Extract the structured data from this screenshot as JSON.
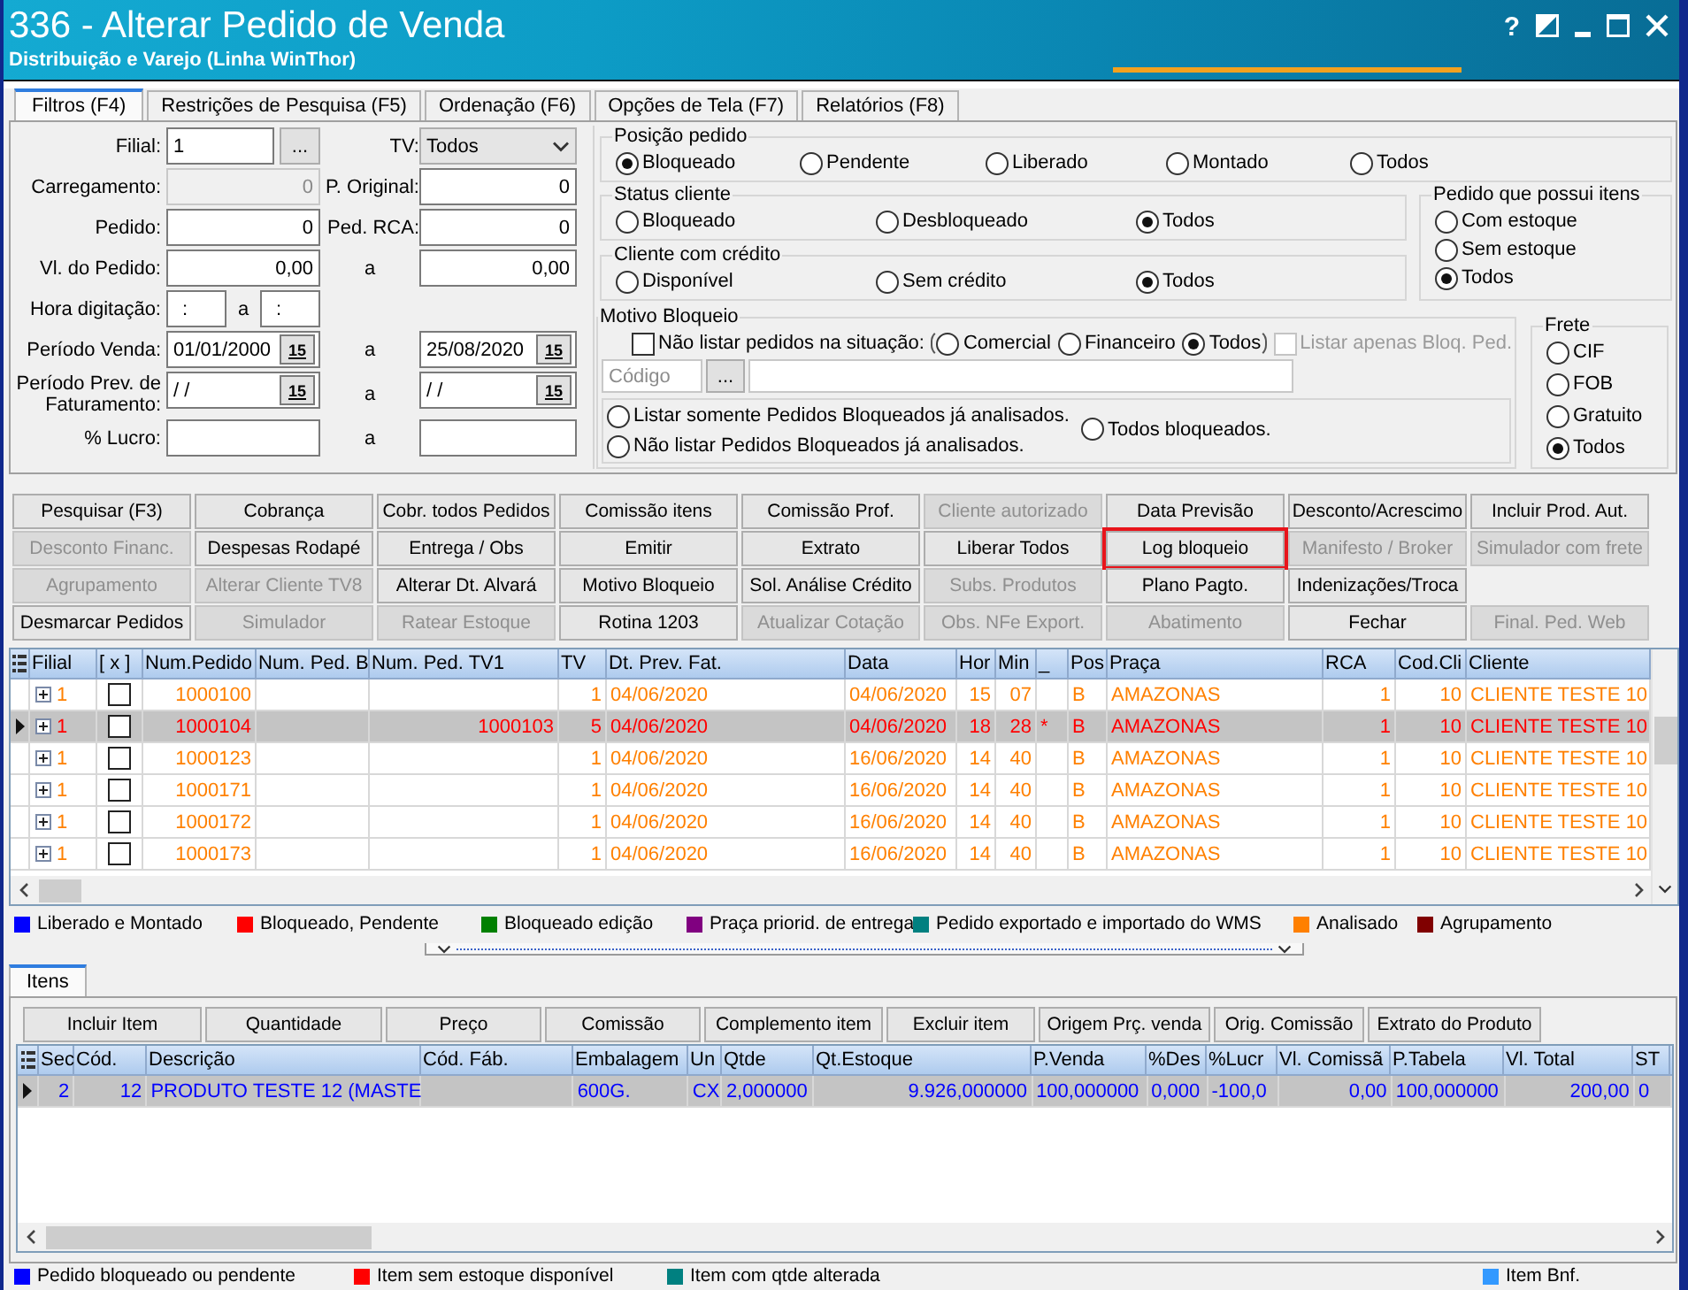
{
  "window": {
    "title": "336 - Alterar Pedido de Venda",
    "subtitle": "Distribuição e Varejo (Linha WinThor)",
    "help": "?"
  },
  "tabs": [
    {
      "label": "Filtros (F4)",
      "selected": true
    },
    {
      "label": "Restrições de Pesquisa (F5)",
      "selected": false
    },
    {
      "label": "Ordenação (F6)",
      "selected": false
    },
    {
      "label": "Opções de Tela (F7)",
      "selected": false
    },
    {
      "label": "Relatórios (F8)",
      "selected": false
    }
  ],
  "form_rows": [
    {
      "kind": "pair",
      "label": "Filial:",
      "field": {
        "kind": "lookup",
        "value": "1",
        "button": "...",
        "disabled": false
      },
      "mid_label": "TV:",
      "field2": {
        "kind": "select",
        "value": "Todos",
        "disabled": false
      }
    },
    {
      "kind": "pair",
      "label": "Carregamento:",
      "field": {
        "kind": "number",
        "value": "0",
        "disabled": true
      },
      "mid_label": "P. Original:",
      "field2": {
        "kind": "number",
        "value": "0",
        "disabled": false
      }
    },
    {
      "kind": "pair",
      "label": "Pedido:",
      "field": {
        "kind": "number",
        "value": "0",
        "disabled": false
      },
      "mid_label": "Ped. RCA:",
      "field2": {
        "kind": "number",
        "value": "0",
        "disabled": false
      }
    },
    {
      "kind": "range",
      "label": "Vl. do Pedido:",
      "field": {
        "kind": "number",
        "value": "0,00",
        "disabled": false
      },
      "mid_label": "a",
      "field2": {
        "kind": "number",
        "value": "0,00",
        "disabled": false
      }
    },
    {
      "kind": "single",
      "label": "Hora digitação:",
      "field": {
        "kind": "time",
        "value": ":",
        "sep": "a",
        "value2": ":",
        "disabled": false
      }
    },
    {
      "kind": "range",
      "label": "Período Venda:",
      "field": {
        "kind": "date",
        "value": "01/01/2000",
        "picker": "15",
        "disabled": false
      },
      "mid_label": "a",
      "field2": {
        "kind": "date",
        "value": "25/08/2020",
        "picker": "15",
        "disabled": false
      }
    },
    {
      "kind": "range",
      "label": "Período Prev. de Faturamento:",
      "field": {
        "kind": "date",
        "value": "/ /",
        "picker": "15",
        "disabled": false
      },
      "mid_label": "a",
      "field2": {
        "kind": "date",
        "value": "/ /",
        "picker": "15",
        "disabled": false
      }
    },
    {
      "kind": "range",
      "label": "% Lucro:",
      "field": {
        "kind": "number",
        "disabled": false
      },
      "mid_label": "a",
      "field2": {
        "kind": "number",
        "disabled": false
      }
    }
  ],
  "posicao": {
    "title": "Posição pedido",
    "options": [
      {
        "label": "Bloqueado",
        "selected": true
      },
      {
        "label": "Pendente",
        "selected": false
      },
      {
        "label": "Liberado",
        "selected": false
      },
      {
        "label": "Montado",
        "selected": false
      },
      {
        "label": "Todos",
        "selected": false
      }
    ]
  },
  "status_cliente": {
    "title": "Status cliente",
    "options": [
      {
        "label": "Bloqueado",
        "selected": false
      },
      {
        "label": "Desbloqueado",
        "selected": false
      },
      {
        "label": "Todos",
        "selected": true
      }
    ]
  },
  "credito": {
    "title": "Cliente com crédito",
    "options": [
      {
        "label": "Disponível",
        "selected": false
      },
      {
        "label": "Sem crédito",
        "selected": false
      },
      {
        "label": "Todos",
        "selected": true
      }
    ]
  },
  "itens_estoque": {
    "title": "Pedido que possui itens",
    "options": [
      {
        "label": "Com estoque",
        "selected": false
      },
      {
        "label": "Sem estoque",
        "selected": false
      },
      {
        "label": "Todos",
        "selected": true
      }
    ]
  },
  "motivo": {
    "title": "Motivo Bloqueio",
    "exclude": {
      "label": "Não listar pedidos na situação:",
      "checked": false
    },
    "situacao": [
      {
        "label": "Comercial",
        "selected": false
      },
      {
        "label": "Financeiro",
        "selected": false
      },
      {
        "label": "Todos",
        "selected": true
      }
    ],
    "only_blocked": {
      "label": "Listar apenas Bloq. Ped.",
      "checked": false,
      "disabled": true
    },
    "codigo": {
      "placeholder": "Código",
      "button": "..."
    },
    "analise": [
      {
        "label": "Listar somente Pedidos Bloqueados já analisados.",
        "selected": false
      },
      {
        "label": "Não listar Pedidos Bloqueados já analisados.",
        "selected": false
      },
      {
        "label": "Todos bloqueados.",
        "selected": false
      }
    ]
  },
  "frete": {
    "title": "Frete",
    "options": [
      {
        "label": "CIF",
        "selected": false
      },
      {
        "label": "FOB",
        "selected": false
      },
      {
        "label": "Gratuito",
        "selected": false
      },
      {
        "label": "Todos",
        "selected": true
      }
    ]
  },
  "actions": [
    [
      {
        "label": "Pesquisar (F3)",
        "disabled": false,
        "highlighted": false
      },
      {
        "label": "Cobrança",
        "disabled": false,
        "highlighted": false
      },
      {
        "label": "Cobr. todos Pedidos",
        "disabled": false,
        "highlighted": false
      },
      {
        "label": "Comissão itens",
        "disabled": false,
        "highlighted": false
      },
      {
        "label": "Comissão Prof.",
        "disabled": false,
        "highlighted": false
      },
      {
        "label": "Cliente autorizado",
        "disabled": true,
        "highlighted": false
      },
      {
        "label": "Data Previsão",
        "disabled": false,
        "highlighted": false
      },
      {
        "label": "Desconto/Acrescimo",
        "disabled": false,
        "highlighted": false
      },
      {
        "label": "Incluir Prod. Aut.",
        "disabled": false,
        "highlighted": false
      }
    ],
    [
      {
        "label": "Desconto Financ.",
        "disabled": true,
        "highlighted": false
      },
      {
        "label": "Despesas Rodapé",
        "disabled": false,
        "highlighted": false
      },
      {
        "label": "Entrega / Obs",
        "disabled": false,
        "highlighted": false
      },
      {
        "label": "Emitir",
        "disabled": false,
        "highlighted": false
      },
      {
        "label": "Extrato",
        "disabled": false,
        "highlighted": false
      },
      {
        "label": "Liberar Todos",
        "disabled": false,
        "highlighted": false
      },
      {
        "label": "Log bloqueio",
        "disabled": false,
        "highlighted": true
      },
      {
        "label": "Manifesto / Broker",
        "disabled": true,
        "highlighted": false
      },
      {
        "label": "Simulador com frete",
        "disabled": true,
        "highlighted": false
      }
    ],
    [
      {
        "label": "Agrupamento",
        "disabled": true,
        "highlighted": false
      },
      {
        "label": "Alterar Cliente TV8",
        "disabled": true,
        "highlighted": false
      },
      {
        "label": "Alterar Dt. Alvará",
        "disabled": false,
        "highlighted": false
      },
      {
        "label": "Motivo Bloqueio",
        "disabled": false,
        "highlighted": false
      },
      {
        "label": "Sol. Análise Crédito",
        "disabled": false,
        "highlighted": false
      },
      {
        "label": "Subs. Produtos",
        "disabled": true,
        "highlighted": false
      },
      {
        "label": "Plano Pagto.",
        "disabled": false,
        "highlighted": false
      },
      {
        "label": "Indenizações/Troca",
        "disabled": false,
        "highlighted": false
      }
    ],
    [
      {
        "label": "Desmarcar Pedidos",
        "disabled": false,
        "highlighted": false
      },
      {
        "label": "Simulador",
        "disabled": true,
        "highlighted": false
      },
      {
        "label": "Ratear Estoque",
        "disabled": true,
        "highlighted": false
      },
      {
        "label": "Rotina 1203",
        "disabled": false,
        "highlighted": false
      },
      {
        "label": "Atualizar Cotação",
        "disabled": true,
        "highlighted": false
      },
      {
        "label": "Obs. NFe Export.",
        "disabled": true,
        "highlighted": false
      },
      {
        "label": "Abatimento",
        "disabled": true,
        "highlighted": false
      },
      {
        "label": "Fechar",
        "disabled": false,
        "highlighted": false
      },
      {
        "label": "Final. Ped. Web",
        "disabled": true,
        "highlighted": false
      }
    ]
  ],
  "orders": {
    "columns": [
      "Filial",
      "[ x ]",
      "Num.Pedido",
      "Num. Ped. B",
      "Num. Ped. TV1",
      "TV",
      "Dt. Prev. Fat.",
      "Data",
      "Hor",
      "Min",
      "_",
      "Pos",
      "Praça",
      "RCA",
      "Cod.Cli",
      "Cliente"
    ],
    "rows": [
      {
        "selected": false,
        "color": "#ff8000",
        "expanded": false,
        "checked": false,
        "filial": "1",
        "num_pedido": "1000100",
        "tv": "1",
        "dt_prev_fat": "04/06/2020",
        "data": "04/06/2020",
        "hora": "15",
        "minuto": "07",
        "pos": "B",
        "praca": "AMAZONAS",
        "rca": "1",
        "cod_cli": "10",
        "cliente": "CLIENTE TESTE 10"
      },
      {
        "selected": true,
        "color": "#ff0000",
        "expanded": false,
        "checked": false,
        "filial": "1",
        "num_pedido": "1000104",
        "num_ped_tv1": "1000103",
        "tv": "5",
        "dt_prev_fat": "04/06/2020",
        "data": "04/06/2020",
        "hora": "18",
        "minuto": "28",
        "flag": "*",
        "pos": "B",
        "praca": "AMAZONAS",
        "rca": "1",
        "cod_cli": "10",
        "cliente": "CLIENTE TESTE 10"
      },
      {
        "selected": false,
        "color": "#ff8000",
        "expanded": false,
        "checked": false,
        "filial": "1",
        "num_pedido": "1000123",
        "tv": "1",
        "dt_prev_fat": "04/06/2020",
        "data": "16/06/2020",
        "hora": "14",
        "minuto": "40",
        "pos": "B",
        "praca": "AMAZONAS",
        "rca": "1",
        "cod_cli": "10",
        "cliente": "CLIENTE TESTE 10"
      },
      {
        "selected": false,
        "color": "#ff8000",
        "expanded": false,
        "checked": false,
        "filial": "1",
        "num_pedido": "1000171",
        "tv": "1",
        "dt_prev_fat": "04/06/2020",
        "data": "16/06/2020",
        "hora": "14",
        "minuto": "40",
        "pos": "B",
        "praca": "AMAZONAS",
        "rca": "1",
        "cod_cli": "10",
        "cliente": "CLIENTE TESTE 10"
      },
      {
        "selected": false,
        "color": "#ff8000",
        "expanded": false,
        "checked": false,
        "filial": "1",
        "num_pedido": "1000172",
        "tv": "1",
        "dt_prev_fat": "04/06/2020",
        "data": "16/06/2020",
        "hora": "14",
        "minuto": "40",
        "pos": "B",
        "praca": "AMAZONAS",
        "rca": "1",
        "cod_cli": "10",
        "cliente": "CLIENTE TESTE 10"
      },
      {
        "selected": false,
        "color": "#ff8000",
        "expanded": false,
        "checked": false,
        "filial": "1",
        "num_pedido": "1000173",
        "tv": "1",
        "dt_prev_fat": "04/06/2020",
        "data": "16/06/2020",
        "hora": "14",
        "minuto": "40",
        "pos": "B",
        "praca": "AMAZONAS",
        "rca": "1",
        "cod_cli": "10",
        "cliente": "CLIENTE TESTE 10"
      }
    ]
  },
  "order_legend": [
    {
      "label": "Liberado e Montado",
      "color": "#0000ff"
    },
    {
      "label": "Bloqueado, Pendente",
      "color": "#ff0000"
    },
    {
      "label": "Bloqueado edição",
      "color": "#008000"
    },
    {
      "label": "Praça priorid. de entrega",
      "color": "#800080"
    },
    {
      "label": "Pedido exportado e importado do WMS",
      "color": "#008080"
    },
    {
      "label": "Analisado",
      "color": "#ff8000"
    },
    {
      "label": "Agrupamento",
      "color": "#800000"
    }
  ],
  "item_tabs": [
    {
      "label": "Itens",
      "selected": true
    }
  ],
  "item_actions": [
    {
      "label": "Incluir Item"
    },
    {
      "label": "Quantidade"
    },
    {
      "label": "Preço"
    },
    {
      "label": "Comissão"
    },
    {
      "label": "Complemento item"
    },
    {
      "label": "Excluir item"
    },
    {
      "label": "Origem Prç. venda"
    },
    {
      "label": "Orig. Comissão"
    },
    {
      "label": "Extrato do Produto"
    }
  ],
  "items": {
    "columns": [
      "Sec",
      "Cód.",
      "Descrição",
      "Cód. Fáb.",
      "Embalagem",
      "Un",
      "Qtde",
      "Qt.Estoque",
      "P.Venda",
      "%Des",
      "%Lucr",
      "Vl. Comissã",
      "P.Tabela",
      "Vl. Total",
      "ST"
    ],
    "rows": [
      {
        "selected": true,
        "sec": "2",
        "cod": "12",
        "descricao": "PRODUTO TESTE 12 (MASTE",
        "embalagem": "600G.",
        "un": "CX",
        "qtde": "2,000000",
        "qt_estoque": "9.926,000000",
        "p_venda": "100,000000",
        "desc": "0,000",
        "lucro": "-100,0",
        "vl_comissao": "0,00",
        "p_tabela": "100,000000",
        "vl_total": "200,00",
        "st": "0"
      }
    ]
  },
  "item_legend": [
    {
      "label": "Pedido bloqueado ou pendente",
      "color": "#0000ff"
    },
    {
      "label": "Item sem estoque disponível",
      "color": "#ff0000"
    },
    {
      "label": "Item com qtde alterada",
      "color": "#008080"
    },
    {
      "label": "Item Bnf.",
      "color": "#3399ff"
    }
  ]
}
